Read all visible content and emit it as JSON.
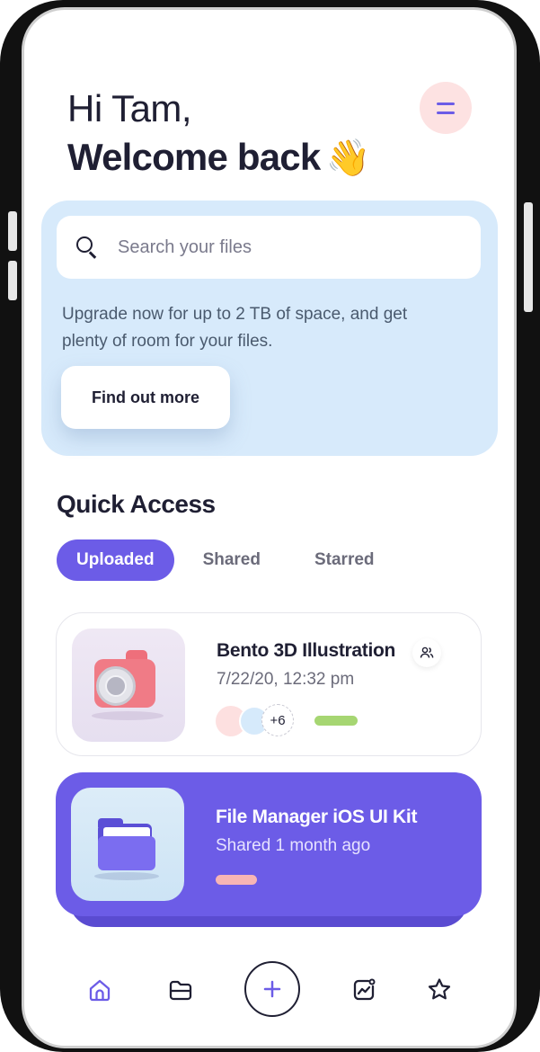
{
  "header": {
    "greeting": "Hi Tam,",
    "welcome": "Welcome back",
    "wave_emoji": "👋"
  },
  "promo": {
    "search_placeholder": "Search your files",
    "text": "Upgrade now for up to 2 TB of space, and get plenty of room for your files.",
    "cta_label": "Find out more"
  },
  "quick_access": {
    "title": "Quick Access",
    "tabs": [
      {
        "label": "Uploaded",
        "active": true
      },
      {
        "label": "Shared",
        "active": false
      },
      {
        "label": "Starred",
        "active": false
      }
    ],
    "files": [
      {
        "title": "Bento 3D Illustration",
        "meta": "7/22/20, 12:32 pm",
        "extra_members": "+6",
        "thumbnail": "camera",
        "progress_color": "#a6d672"
      },
      {
        "title": "File Manager iOS UI Kit",
        "meta": "Shared 1 month ago",
        "thumbnail": "folder",
        "progress_color": "#f7b5b5"
      }
    ]
  },
  "bottom_nav": {
    "items": [
      "home-icon",
      "folder-icon",
      "add-icon",
      "activity-icon",
      "star-icon"
    ],
    "active": "home-icon"
  },
  "colors": {
    "accent": "#6c5ce7",
    "promo_bg": "#d7eafb",
    "menu_bg": "#fde2e2",
    "text_dark": "#1f1f33"
  }
}
